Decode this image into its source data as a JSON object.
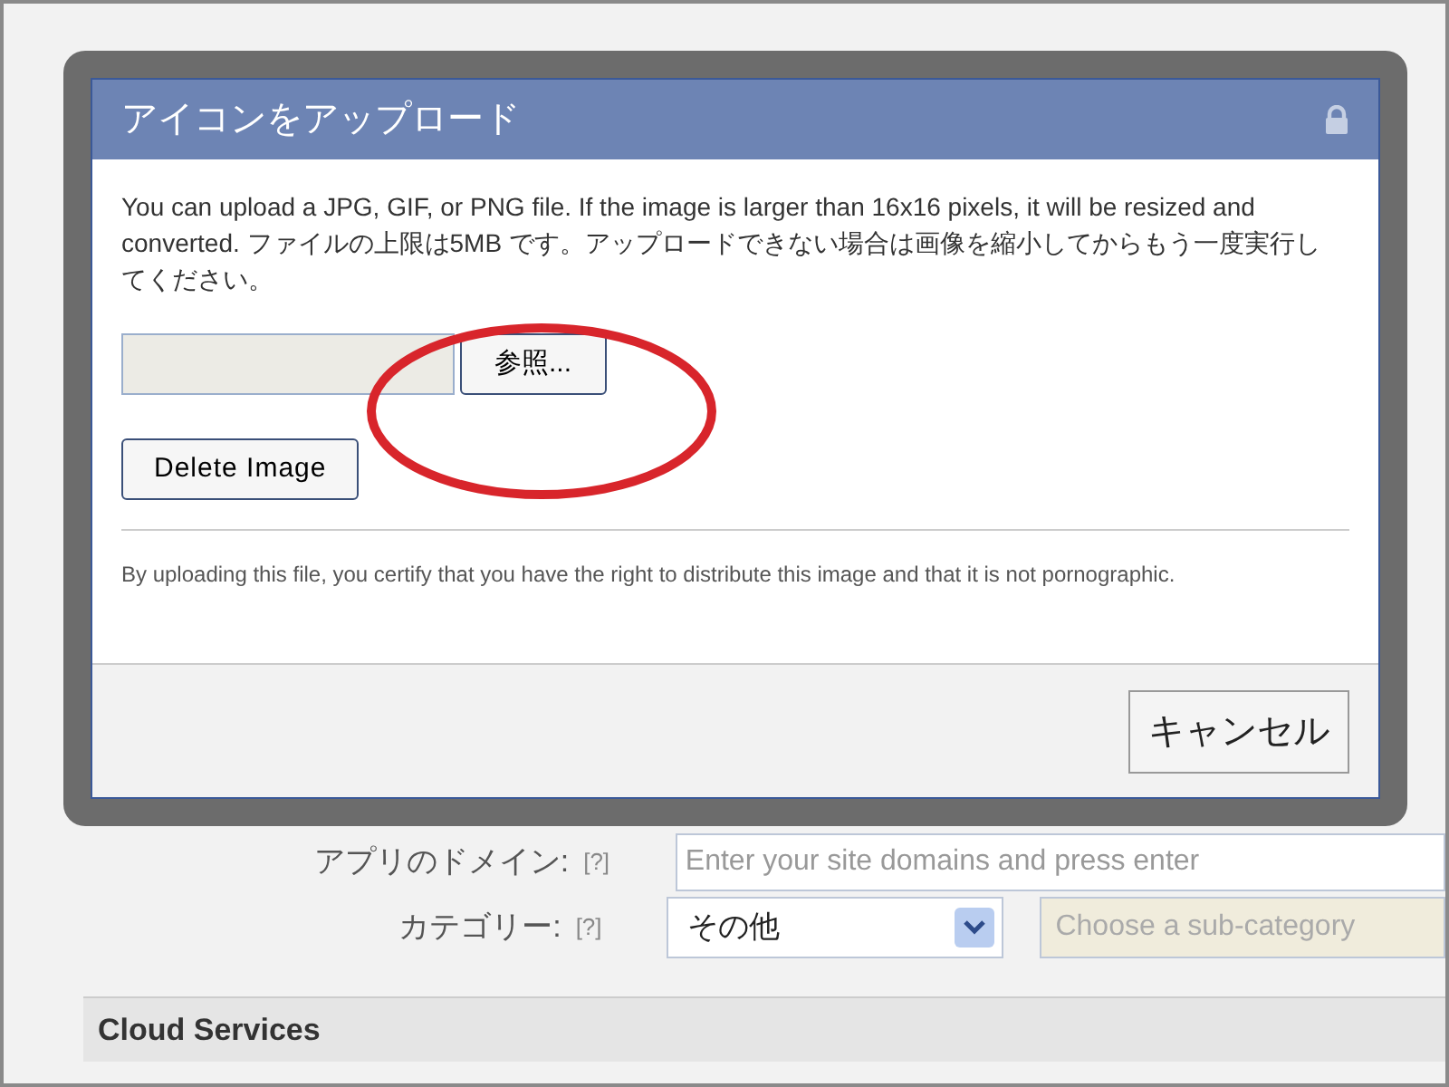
{
  "form": {
    "fields": [
      {
        "kind": "text",
        "label": "アプリのドメイン:",
        "help": "[?]",
        "placeholder": "Enter your site domains and press enter"
      },
      {
        "kind": "select",
        "label": "カテゴリー:",
        "help": "[?]",
        "value": "その他",
        "sub_select": {
          "placeholder": "Choose a sub-category",
          "disabled": true
        }
      }
    ]
  },
  "section_title": "Cloud Services",
  "dialog": {
    "title": "アイコンをアップロード",
    "description": "You can upload a JPG, GIF, or PNG file. If the image is larger than 16x16 pixels, it will be resized and converted. ファイルの上限は5MB です。アップロードできない場合は画像を縮小してからもう一度実行してください。",
    "browse_button": "参照...",
    "delete_button": "Delete Image",
    "disclaimer": "By uploading this file, you certify that you have the right to distribute this image and that it is not pornographic.",
    "cancel_button": "キャンセル"
  }
}
